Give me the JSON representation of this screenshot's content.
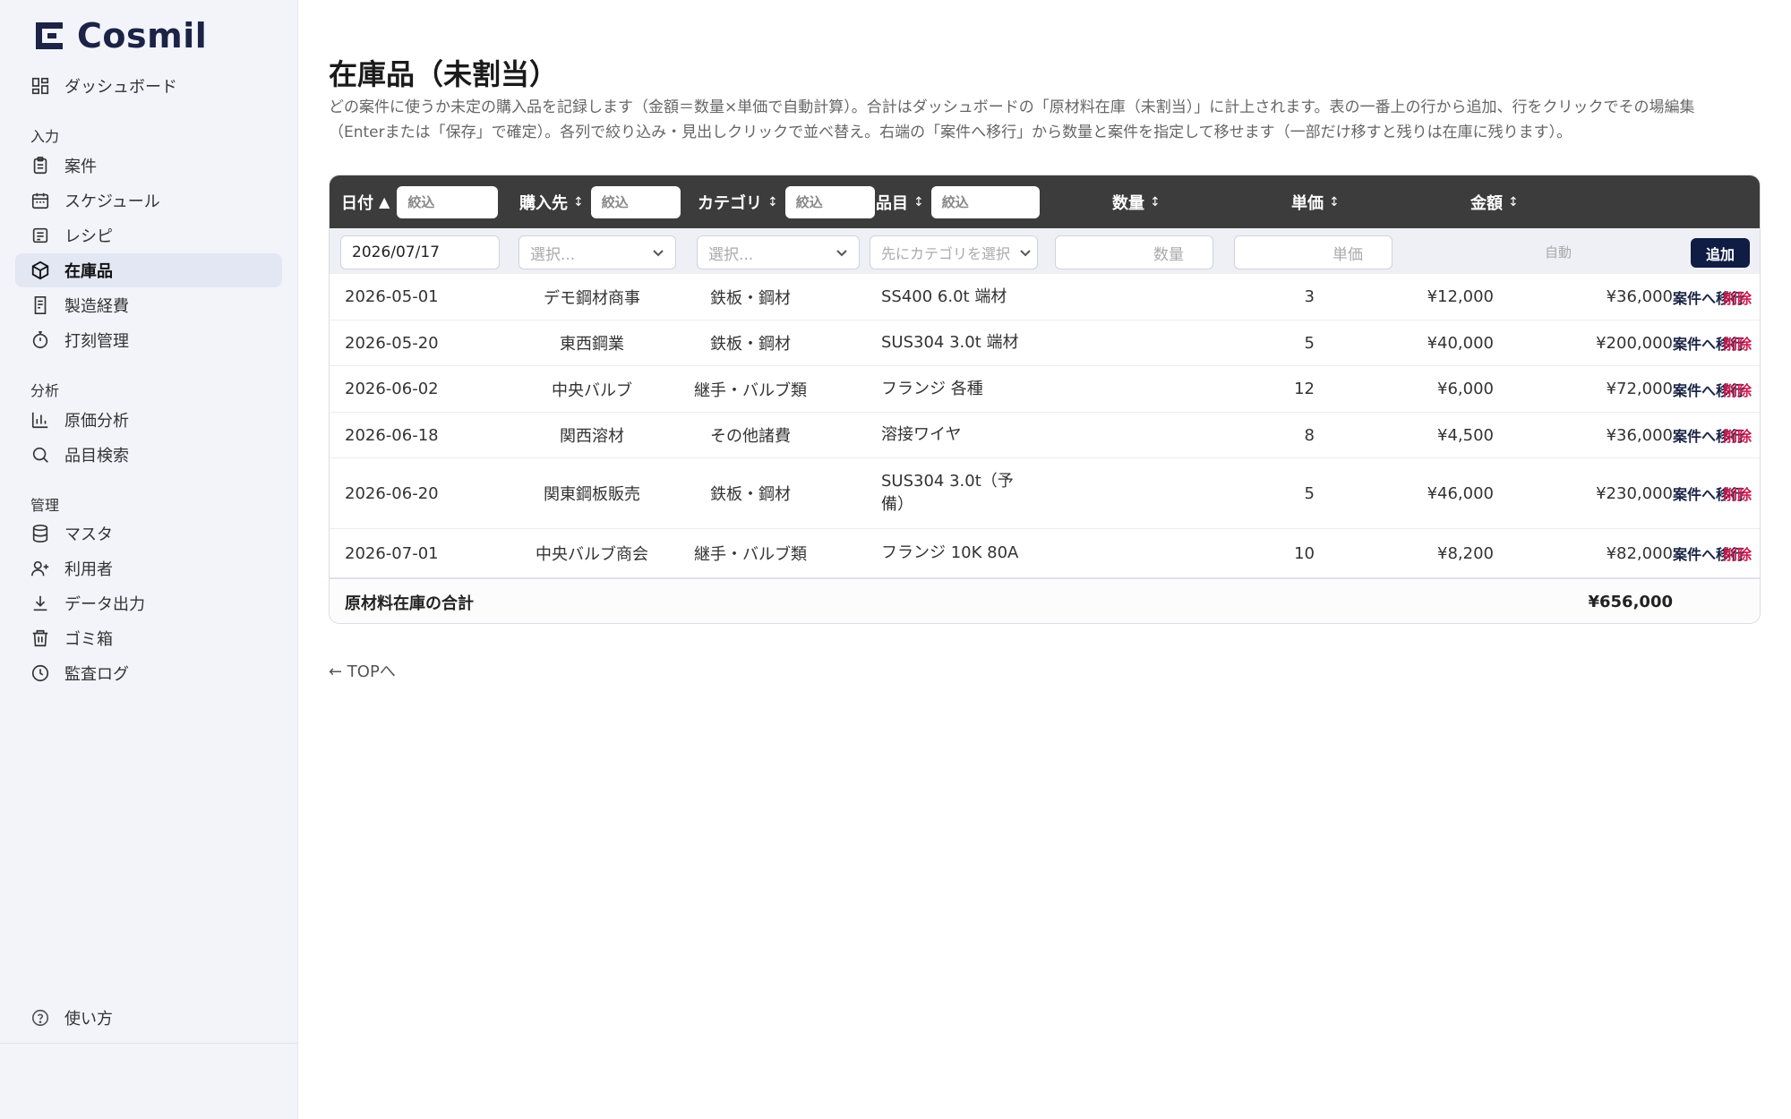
{
  "brand": {
    "name": "Cosmil"
  },
  "sidebar": {
    "top_items": [
      {
        "label": "ダッシュボード",
        "icon": "dashboard-icon"
      }
    ],
    "sections": [
      {
        "title": "入力",
        "items": [
          {
            "label": "案件",
            "icon": "clipboard-icon"
          },
          {
            "label": "スケジュール",
            "icon": "calendar-icon"
          },
          {
            "label": "レシピ",
            "icon": "recipe-icon"
          },
          {
            "label": "在庫品",
            "icon": "box-icon",
            "active": true
          },
          {
            "label": "製造経費",
            "icon": "receipt-icon"
          },
          {
            "label": "打刻管理",
            "icon": "timer-icon"
          }
        ]
      },
      {
        "title": "分析",
        "items": [
          {
            "label": "原価分析",
            "icon": "bar-chart-icon"
          },
          {
            "label": "品目検索",
            "icon": "search-icon"
          }
        ]
      },
      {
        "title": "管理",
        "items": [
          {
            "label": "マスタ",
            "icon": "database-icon"
          },
          {
            "label": "利用者",
            "icon": "user-plus-icon"
          },
          {
            "label": "データ出力",
            "icon": "download-icon"
          },
          {
            "label": "ゴミ箱",
            "icon": "trash-icon"
          },
          {
            "label": "監査ログ",
            "icon": "clock-icon"
          }
        ]
      }
    ],
    "help": {
      "label": "使い方",
      "icon": "help-icon"
    }
  },
  "page": {
    "title": "在庫品（未割当）",
    "description": "どの案件に使うか未定の購入品を記録します（金額＝数量×単価で自動計算）。合計はダッシュボードの「原材料在庫（未割当）」に計上されます。表の一番上の行から追加、行をクリックでその場編集（Enterまたは「保存」で確定）。各列で絞り込み・見出しクリックで並べ替え。右端の「案件へ移行」から数量と案件を指定して移せます（一部だけ移すと残りは在庫に残ります）。"
  },
  "table": {
    "headers": {
      "date": "日付",
      "vendor": "購入先",
      "category": "カテゴリ",
      "item": "品目",
      "qty": "数量",
      "unit_price": "単価",
      "amount": "金額"
    },
    "sort_asc": "▲",
    "sort_both": "↕",
    "filter_placeholder": "絞込",
    "add_row": {
      "date": "2026/07/17",
      "vendor_placeholder": "選択...",
      "category_placeholder": "選択...",
      "item_placeholder": "先にカテゴリを選択",
      "qty_placeholder": "数量",
      "price_placeholder": "単価",
      "amount_auto": "自動",
      "add_button": "追加"
    },
    "rows": [
      {
        "date": "2026-05-01",
        "vendor": "デモ鋼材商事",
        "category": "鉄板・鋼材",
        "item": "SS400 6.0t 端材",
        "qty": "3",
        "unit_price": "¥12,000",
        "amount": "¥36,000"
      },
      {
        "date": "2026-05-20",
        "vendor": "東西鋼業",
        "category": "鉄板・鋼材",
        "item": "SUS304 3.0t 端材",
        "qty": "5",
        "unit_price": "¥40,000",
        "amount": "¥200,000"
      },
      {
        "date": "2026-06-02",
        "vendor": "中央バルブ",
        "category": "継手・バルブ類",
        "item": "フランジ 各種",
        "qty": "12",
        "unit_price": "¥6,000",
        "amount": "¥72,000"
      },
      {
        "date": "2026-06-18",
        "vendor": "関西溶材",
        "category": "その他諸費",
        "item": "溶接ワイヤ",
        "qty": "8",
        "unit_price": "¥4,500",
        "amount": "¥36,000"
      },
      {
        "date": "2026-06-20",
        "vendor": "関東鋼板販売",
        "category": "鉄板・鋼材",
        "item": "SUS304 3.0t（予備）",
        "qty": "5",
        "unit_price": "¥46,000",
        "amount": "¥230,000"
      },
      {
        "date": "2026-07-01",
        "vendor": "中央バルブ商会",
        "category": "継手・バルブ類",
        "item": "フランジ 10K 80A",
        "qty": "10",
        "unit_price": "¥8,200",
        "amount": "¥82,000"
      }
    ],
    "row_actions": {
      "move": "案件へ移行",
      "delete": "削除"
    },
    "total": {
      "label": "原材料在庫の合計",
      "value": "¥656,000"
    }
  },
  "back_link": "← TOPへ",
  "colors": {
    "brand_navy": "#1b2446",
    "header_bg": "#3c3c3c",
    "delete_red": "#d0174e",
    "add_btn": "#0f1c44"
  }
}
